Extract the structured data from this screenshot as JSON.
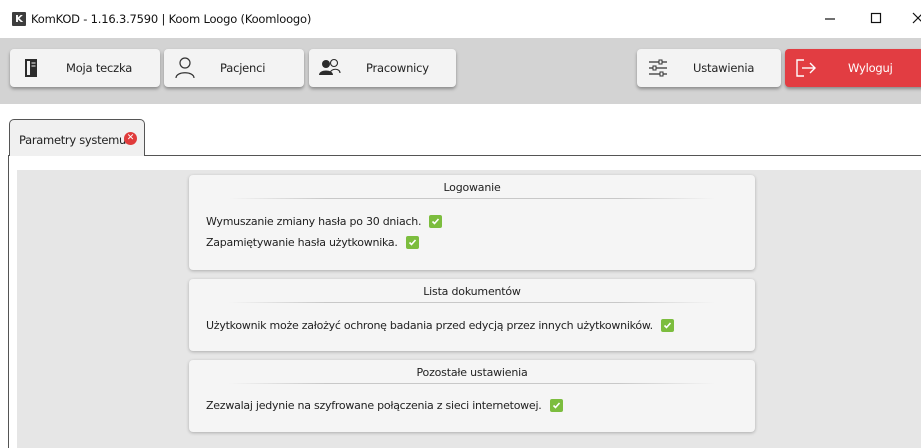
{
  "window": {
    "logo_letter": "K",
    "title": "KomKOD - 1.16.3.7590 | Koom Loogo (Koomloogo)"
  },
  "toolbar": {
    "my_folder_label": "Moja teczka",
    "patients_label": "Pacjenci",
    "staff_label": "Pracownicy",
    "settings_label": "Ustawienia",
    "logout_label": "Wyloguj"
  },
  "tabs": [
    {
      "label": "Parametry systemu",
      "closable": true
    }
  ],
  "sections": [
    {
      "title": "Logowanie",
      "options": [
        {
          "label": "Wymuszanie zmiany hasła po 30 dniach.",
          "checked": true
        },
        {
          "label": "Zapamiętywanie hasła użytkownika.",
          "checked": true
        }
      ]
    },
    {
      "title": "Lista dokumentów",
      "options": [
        {
          "label": "Użytkownik może założyć ochronę badania przed edycją przez innych użytkowników.",
          "checked": true
        }
      ]
    },
    {
      "title": "Pozostałe ustawienia",
      "options": [
        {
          "label": "Zezwalaj jedynie na szyfrowane połączenia z sieci internetowej.",
          "checked": true
        }
      ]
    }
  ],
  "colors": {
    "logout_bg": "#e23d42",
    "checkbox_green": "#7cbd3e",
    "toolbar_bg": "#d3d3d3",
    "content_bg": "#e6e6e6"
  }
}
